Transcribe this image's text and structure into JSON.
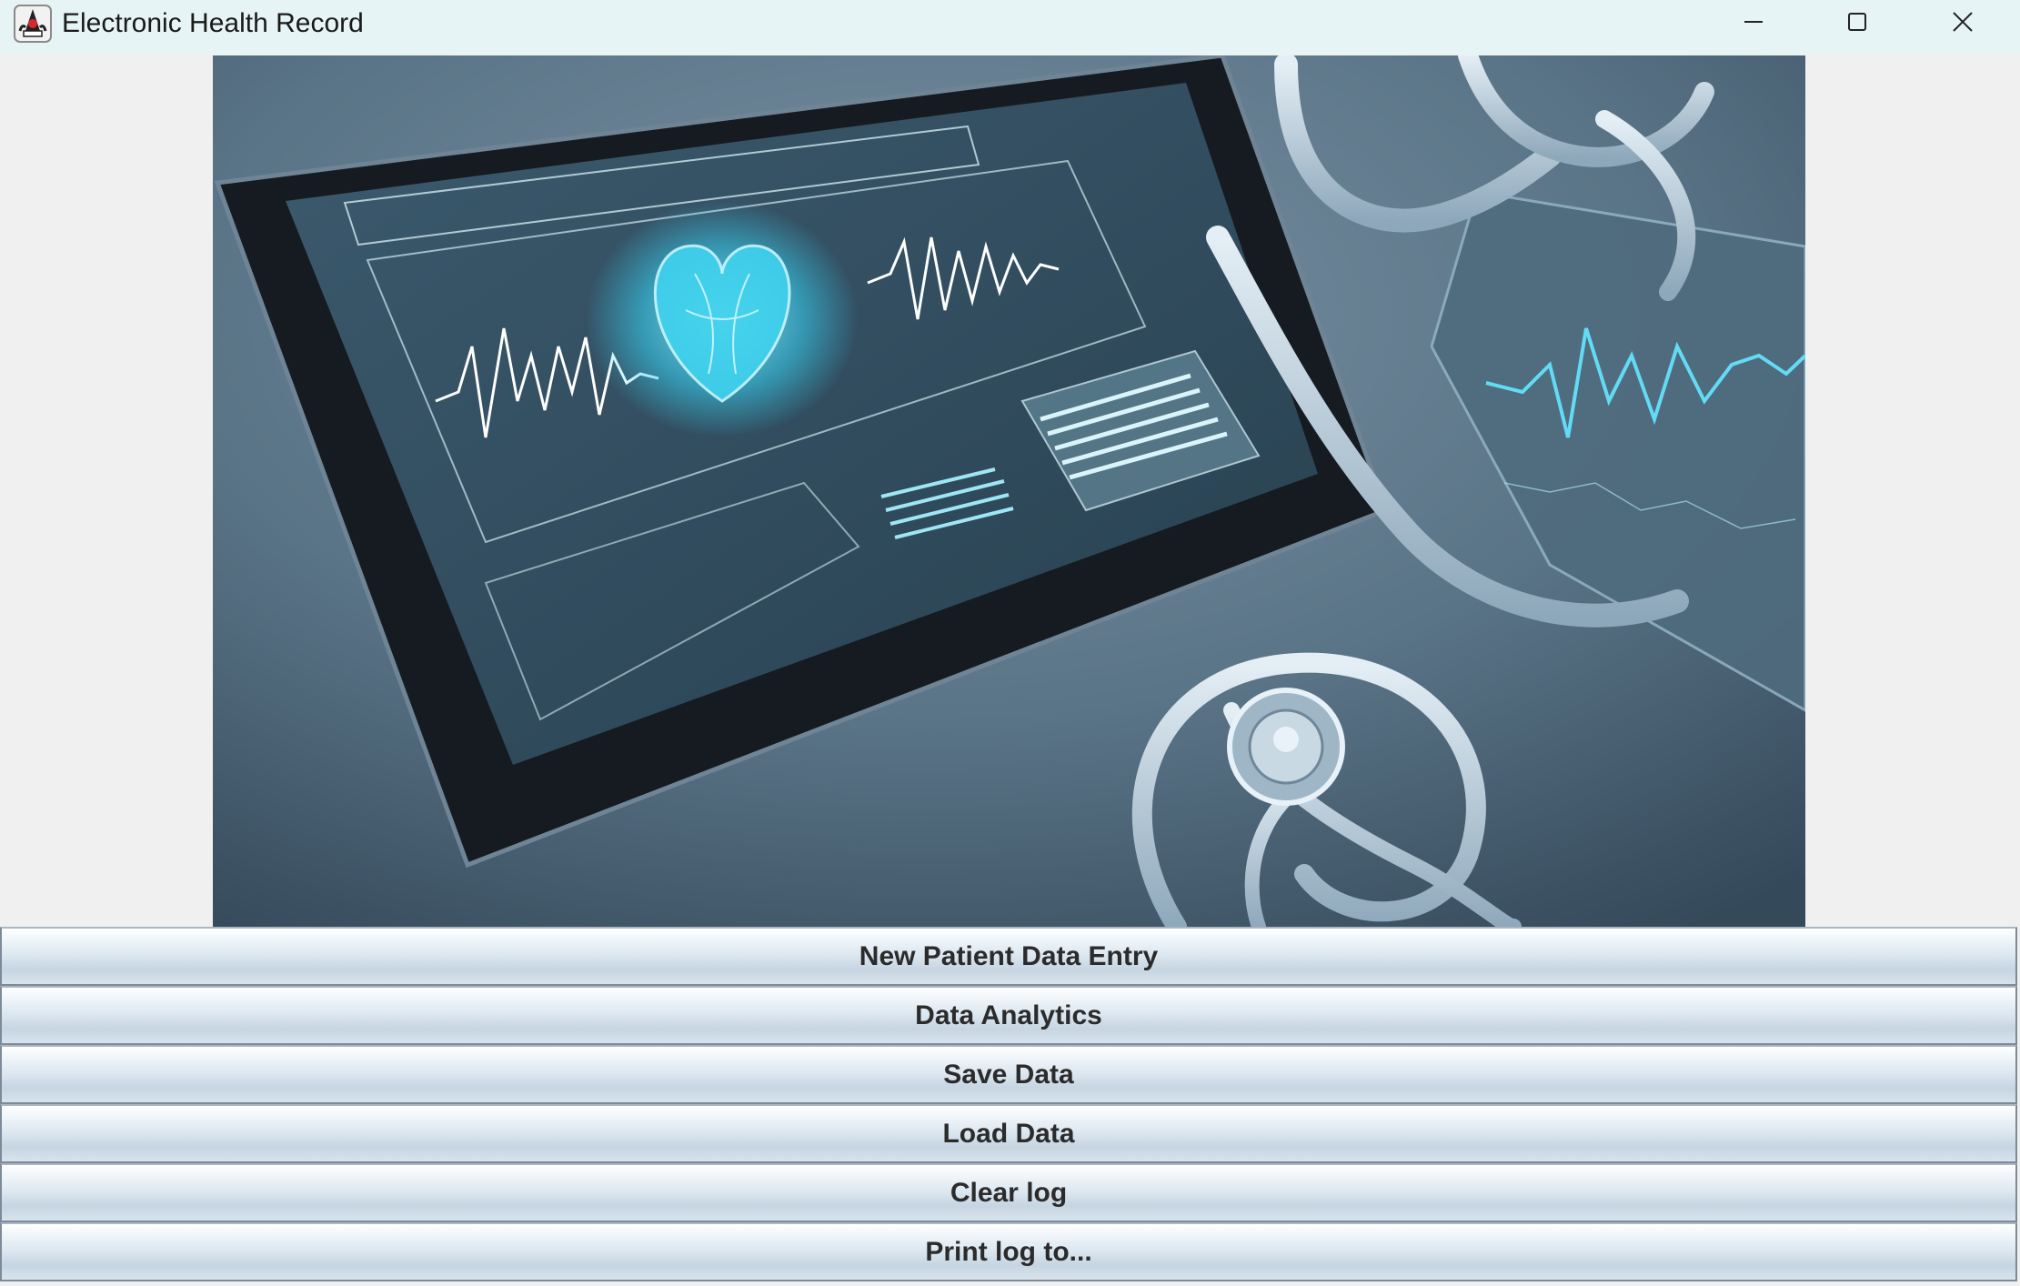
{
  "window": {
    "title": "Electronic Health Record",
    "icon": "java-duke-icon",
    "controls": [
      "minimize-icon",
      "maximize-icon",
      "close-icon"
    ]
  },
  "hero_image": {
    "subject": "digital-tablet-heart-ecg-with-stethoscope",
    "colors": {
      "background": "#5a7486",
      "glow": "#4fd6f0",
      "bezel": "#1b2229"
    }
  },
  "buttons": [
    {
      "label": "New Patient Data Entry"
    },
    {
      "label": "Data Analytics"
    },
    {
      "label": "Save Data"
    },
    {
      "label": "Load Data"
    },
    {
      "label": "Clear log"
    },
    {
      "label": "Print log to..."
    }
  ]
}
